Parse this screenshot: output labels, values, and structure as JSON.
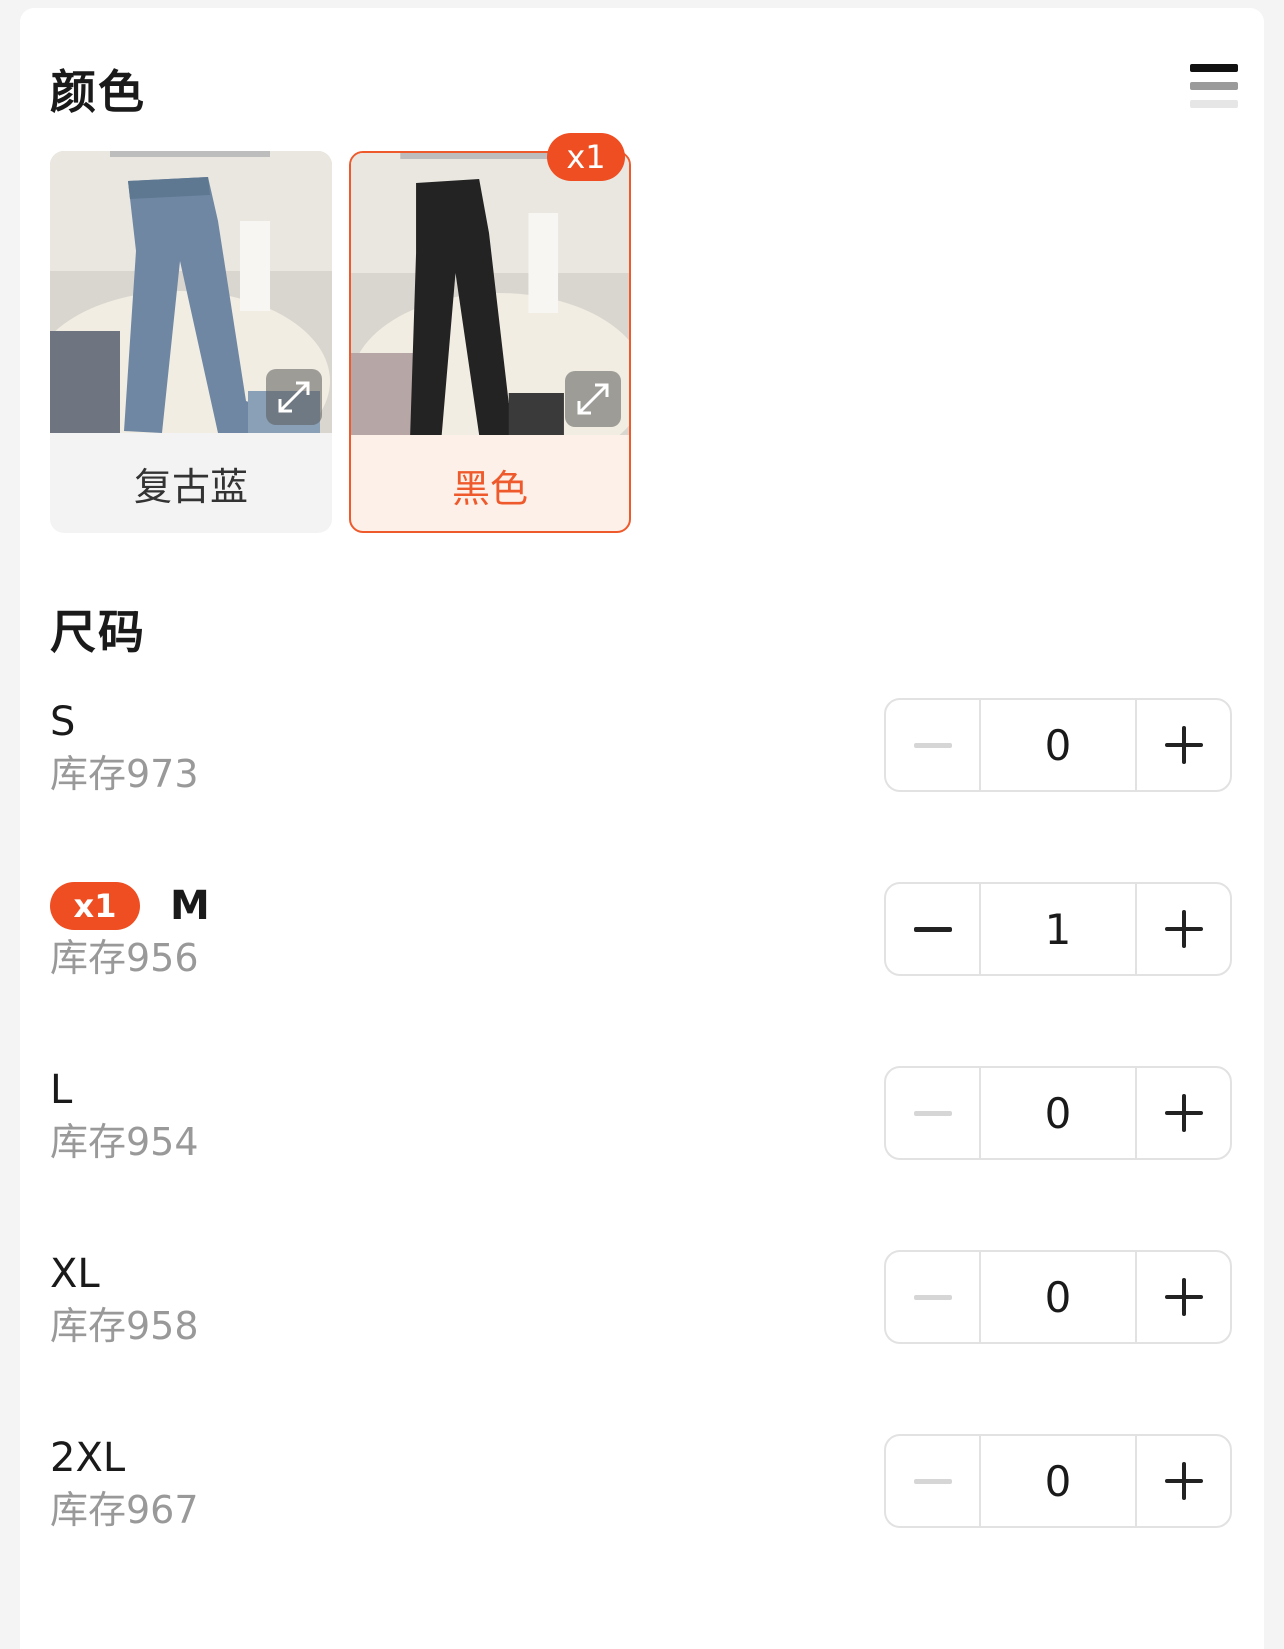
{
  "color_section": {
    "title": "颜色",
    "options": [
      {
        "label": "复古蓝",
        "selected": false,
        "count": ""
      },
      {
        "label": "黑色",
        "selected": true,
        "count": "x1"
      }
    ]
  },
  "size_section": {
    "title": "尺码",
    "rows": [
      {
        "size": "S",
        "stock": "库存973",
        "quantity": "0",
        "badge": ""
      },
      {
        "size": "M",
        "stock": "库存956",
        "quantity": "1",
        "badge": "x1"
      },
      {
        "size": "L",
        "stock": "库存954",
        "quantity": "0",
        "badge": ""
      },
      {
        "size": "XL",
        "stock": "库存958",
        "quantity": "0",
        "badge": ""
      },
      {
        "size": "2XL",
        "stock": "库存967",
        "quantity": "0",
        "badge": ""
      }
    ]
  },
  "colors": {
    "accent": "#ee5a2c",
    "badge": "#ee4e22",
    "muted_text": "#999999"
  },
  "icons": [
    "menu-icon",
    "expand-icon",
    "minus-icon",
    "plus-icon"
  ]
}
